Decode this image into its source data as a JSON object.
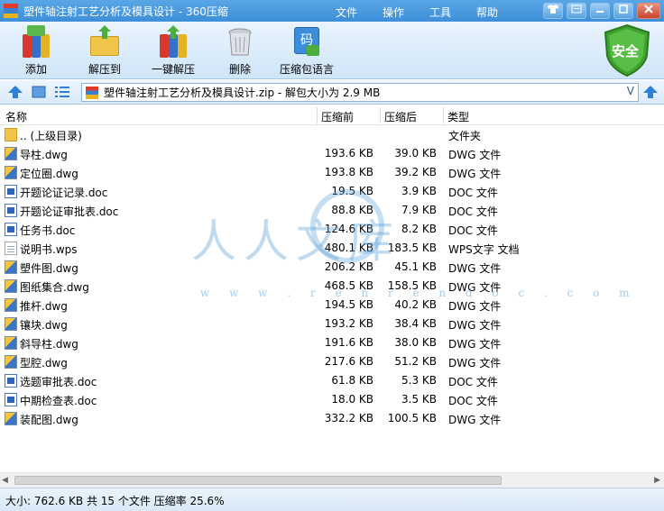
{
  "window": {
    "title": "塑件轴注射工艺分析及模具设计 - 360压缩"
  },
  "menu": [
    "文件",
    "操作",
    "工具",
    "帮助"
  ],
  "toolbar": {
    "items": [
      {
        "label": "添加",
        "icon": "add-archive-icon"
      },
      {
        "label": "解压到",
        "icon": "extract-to-icon"
      },
      {
        "label": "一键解压",
        "icon": "one-click-extract-icon"
      },
      {
        "label": "删除",
        "icon": "delete-trash-icon"
      },
      {
        "label": "压缩包语言",
        "icon": "archive-language-icon"
      }
    ],
    "safe_badge": "安全",
    "language_icon_text": "码"
  },
  "address": {
    "path": "塑件轴注射工艺分析及模具设计.zip - 解包大小为 2.9 MB",
    "dropdown": "V"
  },
  "columns": [
    "名称",
    "压缩前",
    "压缩后",
    "类型"
  ],
  "files": [
    {
      "name": ".. (上级目录)",
      "size": "",
      "compressed": "",
      "type": "文件夹",
      "icon": "folder"
    },
    {
      "name": "导柱.dwg",
      "size": "193.6 KB",
      "compressed": "39.0 KB",
      "type": "DWG 文件",
      "icon": "dwg"
    },
    {
      "name": "定位圈.dwg",
      "size": "193.8 KB",
      "compressed": "39.2 KB",
      "type": "DWG 文件",
      "icon": "dwg"
    },
    {
      "name": "开题论证记录.doc",
      "size": "19.5 KB",
      "compressed": "3.9 KB",
      "type": "DOC 文件",
      "icon": "doc"
    },
    {
      "name": "开题论证审批表.doc",
      "size": "88.8 KB",
      "compressed": "7.9 KB",
      "type": "DOC 文件",
      "icon": "doc"
    },
    {
      "name": "任务书.doc",
      "size": "124.6 KB",
      "compressed": "8.2 KB",
      "type": "DOC 文件",
      "icon": "doc"
    },
    {
      "name": "说明书.wps",
      "size": "480.1 KB",
      "compressed": "183.5 KB",
      "type": "WPS文字 文档",
      "icon": "wps"
    },
    {
      "name": "塑件图.dwg",
      "size": "206.2 KB",
      "compressed": "45.1 KB",
      "type": "DWG 文件",
      "icon": "dwg"
    },
    {
      "name": "图纸集合.dwg",
      "size": "468.5 KB",
      "compressed": "158.5 KB",
      "type": "DWG 文件",
      "icon": "dwg"
    },
    {
      "name": "推杆.dwg",
      "size": "194.5 KB",
      "compressed": "40.2 KB",
      "type": "DWG 文件",
      "icon": "dwg"
    },
    {
      "name": "镶块.dwg",
      "size": "193.2 KB",
      "compressed": "38.4 KB",
      "type": "DWG 文件",
      "icon": "dwg"
    },
    {
      "name": "斜导柱.dwg",
      "size": "191.6 KB",
      "compressed": "38.0 KB",
      "type": "DWG 文件",
      "icon": "dwg"
    },
    {
      "name": "型腔.dwg",
      "size": "217.6 KB",
      "compressed": "51.2 KB",
      "type": "DWG 文件",
      "icon": "dwg"
    },
    {
      "name": "选题审批表.doc",
      "size": "61.8 KB",
      "compressed": "5.3 KB",
      "type": "DOC 文件",
      "icon": "doc"
    },
    {
      "name": "中期检查表.doc",
      "size": "18.0 KB",
      "compressed": "3.5 KB",
      "type": "DOC 文件",
      "icon": "doc"
    },
    {
      "name": "装配图.dwg",
      "size": "332.2 KB",
      "compressed": "100.5 KB",
      "type": "DWG 文件",
      "icon": "dwg"
    }
  ],
  "watermark": {
    "text": "人人文库",
    "url": "w w w . r e n r e n d o c . c o m"
  },
  "status": "大小: 762.6 KB 共 15 个文件 压缩率 25.6%"
}
